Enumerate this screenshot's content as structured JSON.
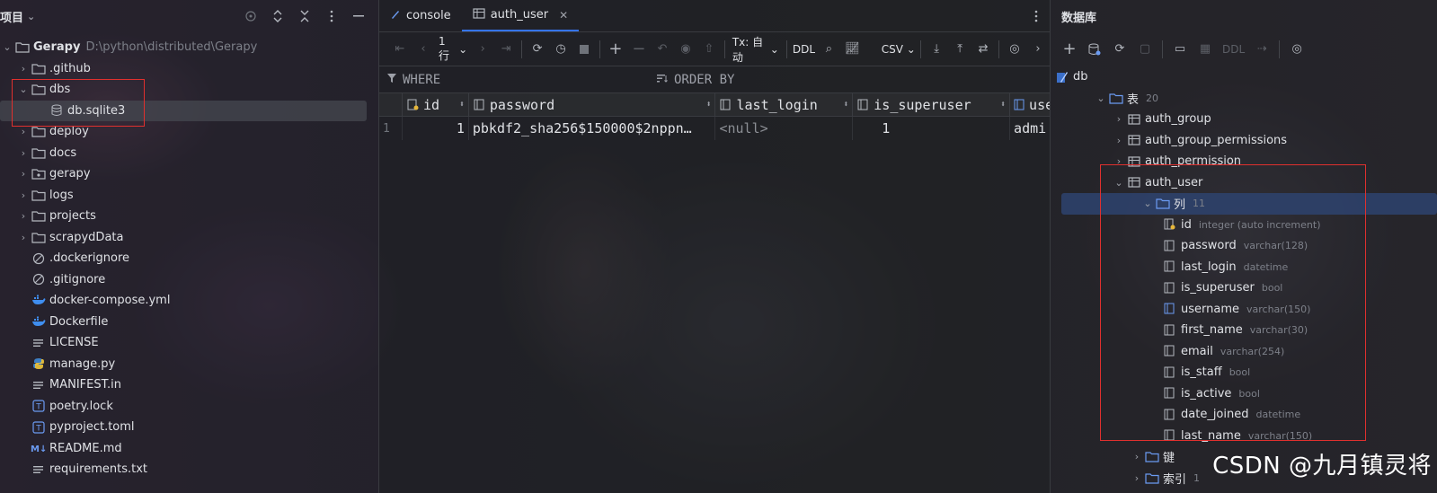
{
  "project": {
    "title": "项目",
    "root": {
      "name": "Gerapy",
      "path": "D:\\python\\distributed\\Gerapy"
    },
    "items": [
      {
        "label": ".github",
        "kind": "folder",
        "expandable": true
      },
      {
        "label": "dbs",
        "kind": "folder",
        "expandable": true,
        "expanded": true
      },
      {
        "label": "db.sqlite3",
        "kind": "db",
        "child": true
      },
      {
        "label": "deploy",
        "kind": "folder",
        "expandable": true
      },
      {
        "label": "docs",
        "kind": "folder",
        "expandable": true
      },
      {
        "label": "gerapy",
        "kind": "package",
        "expandable": true
      },
      {
        "label": "logs",
        "kind": "folder",
        "expandable": true
      },
      {
        "label": "projects",
        "kind": "folder",
        "expandable": true
      },
      {
        "label": "scrapydData",
        "kind": "folder",
        "expandable": true
      },
      {
        "label": ".dockerignore",
        "kind": "ignore"
      },
      {
        "label": ".gitignore",
        "kind": "ignore"
      },
      {
        "label": "docker-compose.yml",
        "kind": "docker"
      },
      {
        "label": "Dockerfile",
        "kind": "docker"
      },
      {
        "label": "LICENSE",
        "kind": "text"
      },
      {
        "label": "manage.py",
        "kind": "python"
      },
      {
        "label": "MANIFEST.in",
        "kind": "text"
      },
      {
        "label": "poetry.lock",
        "kind": "toml"
      },
      {
        "label": "pyproject.toml",
        "kind": "toml"
      },
      {
        "label": "README.md",
        "kind": "markdown"
      },
      {
        "label": "requirements.txt",
        "kind": "text"
      }
    ]
  },
  "editor": {
    "tabs": [
      {
        "label": "console",
        "active": false
      },
      {
        "label": "auth_user",
        "active": true
      }
    ],
    "toolbar": {
      "rows": "1 行",
      "tx": "Tx: 自动",
      "ddl": "DDL",
      "format": "CSV"
    },
    "filter": {
      "where": "WHERE",
      "order_by": "ORDER BY"
    },
    "columns": [
      "id",
      "password",
      "last_login",
      "is_superuser",
      "use"
    ],
    "rows": [
      {
        "num": "1",
        "id": "1",
        "password": "pbkdf2_sha256$150000$2nppn…",
        "last_login": "<null>",
        "is_superuser": "1",
        "username": "admi"
      }
    ]
  },
  "database": {
    "title": "数据库",
    "toolbar": {
      "ddl": "DDL"
    },
    "db_name": "db",
    "tables_label": "表",
    "tables_count": "20",
    "tables": [
      "auth_group",
      "auth_group_permissions",
      "auth_permission",
      "auth_user"
    ],
    "columns_label": "列",
    "columns_count": "11",
    "columns": [
      {
        "name": "id",
        "type": "integer (auto increment)",
        "icon": "key-column-icon"
      },
      {
        "name": "password",
        "type": "varchar(128)",
        "icon": "column-icon"
      },
      {
        "name": "last_login",
        "type": "datetime",
        "icon": "column-icon"
      },
      {
        "name": "is_superuser",
        "type": "bool",
        "icon": "column-icon"
      },
      {
        "name": "username",
        "type": "varchar(150)",
        "icon": "index-column-icon"
      },
      {
        "name": "first_name",
        "type": "varchar(30)",
        "icon": "column-icon"
      },
      {
        "name": "email",
        "type": "varchar(254)",
        "icon": "column-icon"
      },
      {
        "name": "is_staff",
        "type": "bool",
        "icon": "column-icon"
      },
      {
        "name": "is_active",
        "type": "bool",
        "icon": "column-icon"
      },
      {
        "name": "date_joined",
        "type": "datetime",
        "icon": "column-icon"
      },
      {
        "name": "last_name",
        "type": "varchar(150)",
        "icon": "column-icon"
      }
    ],
    "keys_label": "键",
    "indexes_label": "索引",
    "indexes_count": "1"
  },
  "watermark": "CSDN @九月镇灵将",
  "colors": {
    "highlight_box": "#e0302e",
    "accent": "#3574f0",
    "selection": "#2e436e"
  }
}
